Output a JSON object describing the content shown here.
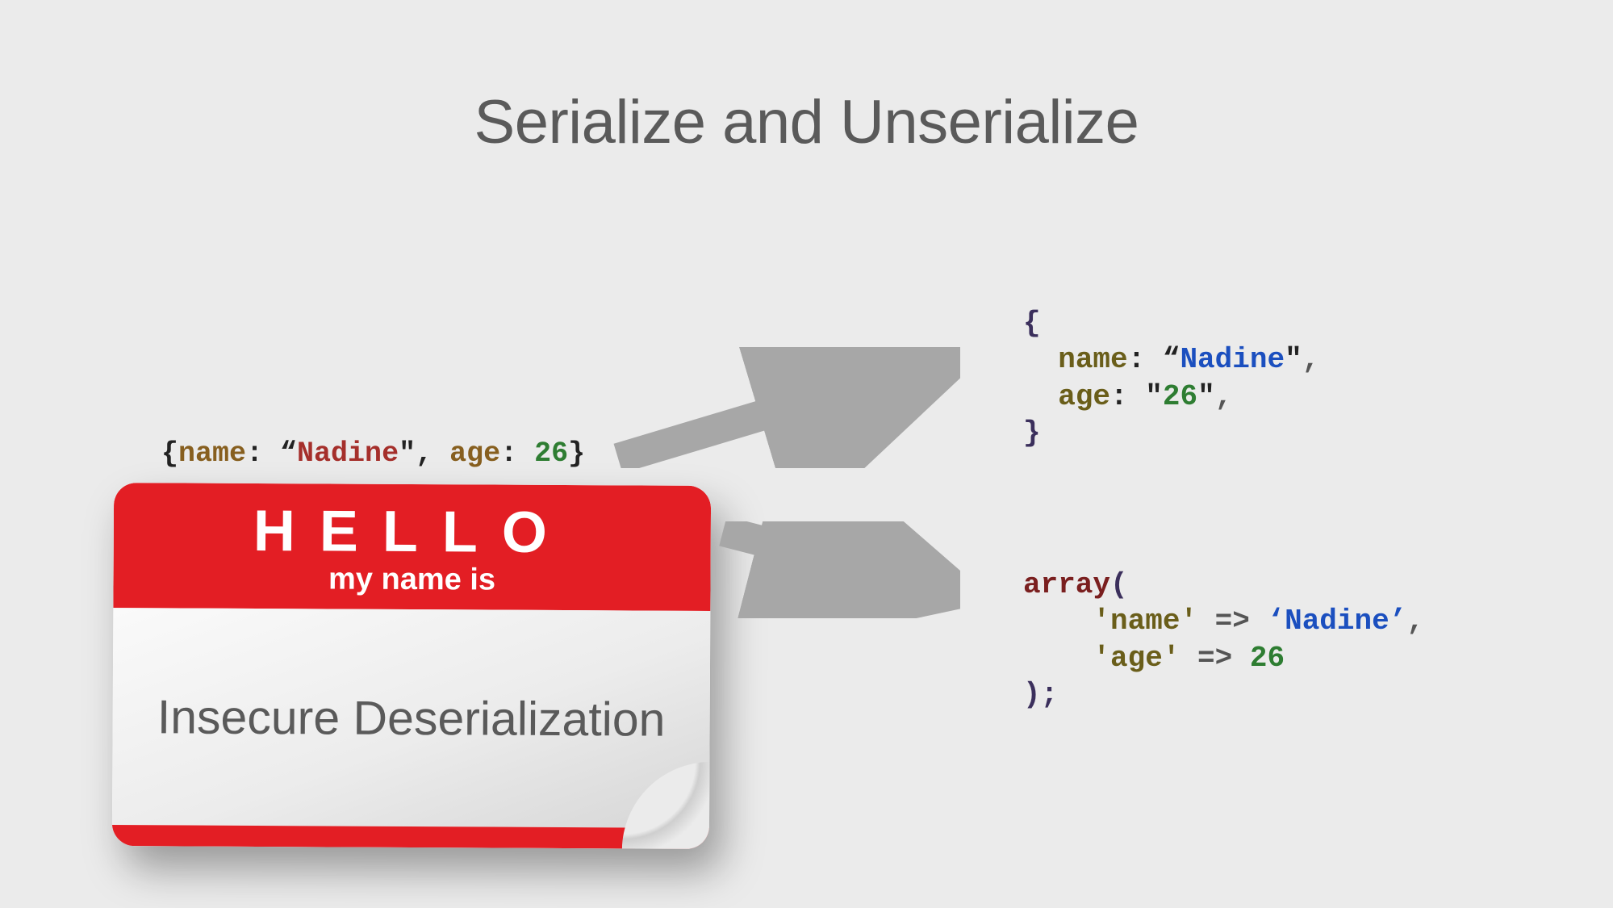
{
  "title": "Serialize and Unserialize",
  "source": {
    "open": "{",
    "name_key": "name",
    "name_colon": ": “",
    "name_val": "Nadine",
    "name_close": "\", ",
    "age_key": "age",
    "age_colon": ": ",
    "age_val": "26",
    "close": "}"
  },
  "nametag": {
    "hello": "HELLO",
    "subtitle": "my name is",
    "label": "Insecure Deserialization"
  },
  "json_output": {
    "l1": "{",
    "l2_pad": "  ",
    "l2_key": "name",
    "l2_colon": ": “",
    "l2_val": "Nadine",
    "l2_close": "\"",
    "l2_comma": ",",
    "l3_pad": "  ",
    "l3_key": "age",
    "l3_colon": ": ",
    "l3_q": "\"",
    "l3_val": "26",
    "l3_q2": "\"",
    "l3_comma": ",",
    "l4": "}"
  },
  "php_output": {
    "l1_array": "array",
    "l1_paren": "(",
    "l2_pad": "    ",
    "l2_q1": "'",
    "l2_key": "name",
    "l2_q2": "'",
    "l2_arrow": " => ",
    "l2_q3": "‘",
    "l2_val": "Nadine",
    "l2_q4": "’",
    "l2_comma": ",",
    "l3_pad": "    ",
    "l3_q1": "'",
    "l3_key": "age",
    "l3_q2": "'",
    "l3_arrow": " => ",
    "l3_val": "26",
    "l4": ");"
  }
}
